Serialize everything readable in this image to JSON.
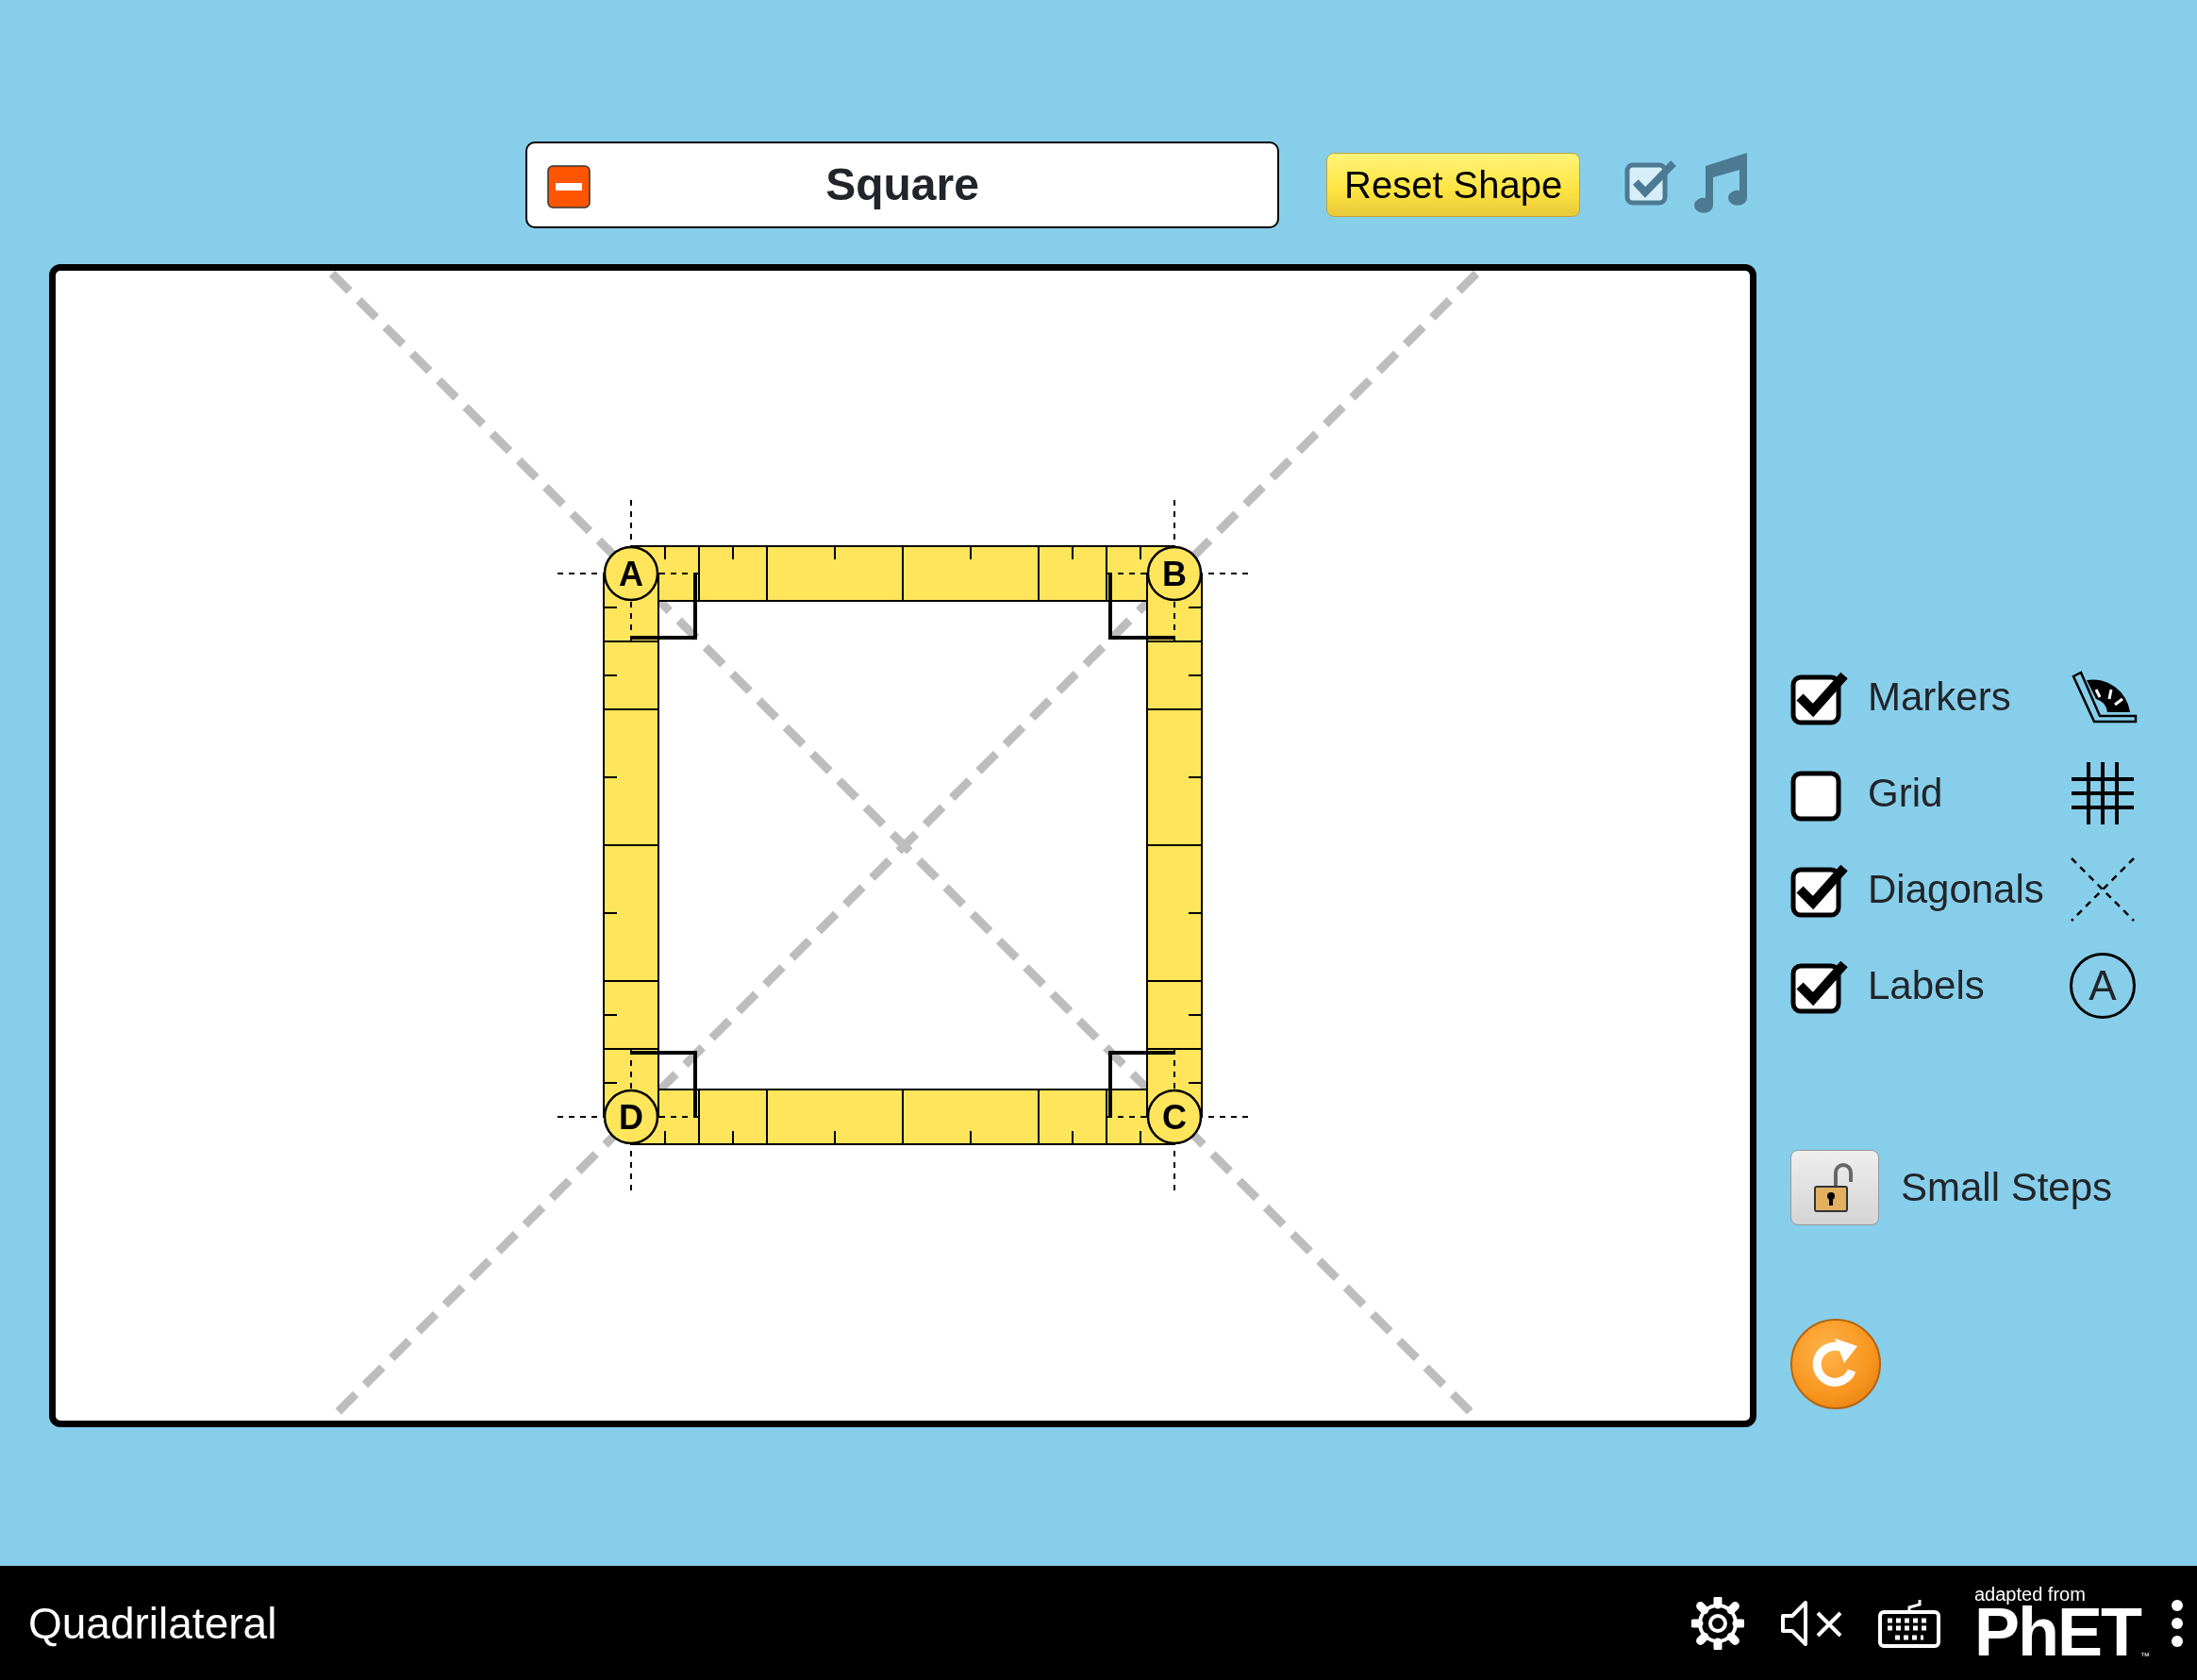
{
  "shape_selector": {
    "label": "Square"
  },
  "reset_shape_button": "Reset Shape",
  "sound": {
    "checked": true
  },
  "vertices": [
    {
      "label": "A"
    },
    {
      "label": "B"
    },
    {
      "label": "D"
    },
    {
      "label": "C"
    }
  ],
  "options": [
    {
      "kind": "markers",
      "label": "Markers",
      "checked": true
    },
    {
      "kind": "grid",
      "label": "Grid",
      "checked": false
    },
    {
      "kind": "diagonals",
      "label": "Diagonals",
      "checked": true
    },
    {
      "kind": "labels",
      "label": "Labels",
      "checked": true,
      "icon_letter": "A"
    }
  ],
  "small_steps": {
    "label": "Small Steps",
    "locked": false
  },
  "footer": {
    "title": "Quadrilateral",
    "adapted_from": "adapted from",
    "logo": "PhET",
    "trademark": "™"
  }
}
